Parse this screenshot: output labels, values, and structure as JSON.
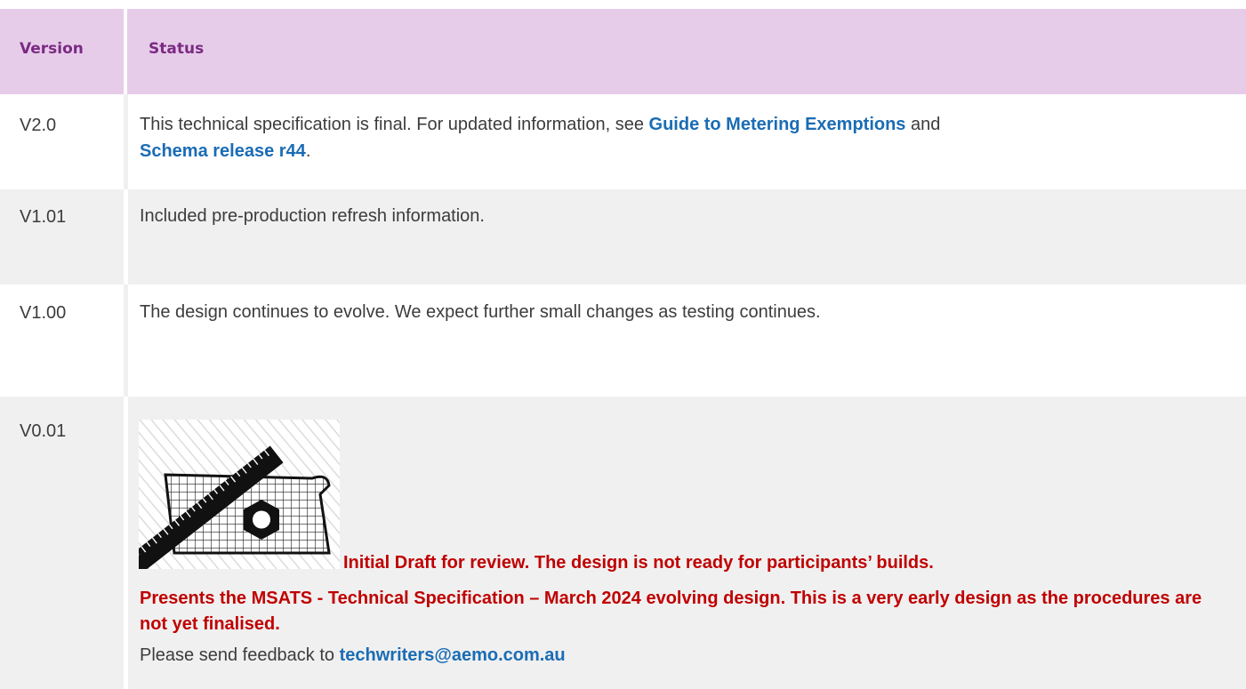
{
  "table": {
    "header": {
      "version": "Version",
      "status": "Status"
    },
    "rows": [
      {
        "version": "V2.0",
        "text_pre": "This technical specification is final. For updated information, see ",
        "link1": "Guide to Metering Exemptions",
        "text_mid": " and ",
        "link2": "Schema release r44",
        "text_post": "."
      },
      {
        "version": "V1.01",
        "text": "Included pre-production refresh information."
      },
      {
        "version": "V1.00",
        "text": "The design continues to evolve. We expect further small changes as testing continues."
      },
      {
        "version": "V0.01",
        "draft_line1": "Initial Draft for review. The design is not ready for participants’ builds.",
        "draft_line2": "Presents the MSATS - Technical Specification – March 2024 evolving design. This is a very early design as the procedures are not yet finalised.",
        "feedback_pre": "Please send feedback to ",
        "feedback_email": "techwriters@aemo.com.au"
      }
    ]
  },
  "colors": {
    "header_bg": "#e6cce9",
    "header_text": "#7b2a83",
    "link": "#1a6cb4",
    "draft_red": "#c00000",
    "row_alt": "#f0f0f0"
  },
  "icons": {
    "draft_image": "ruler-grid-hexnut-icon"
  }
}
